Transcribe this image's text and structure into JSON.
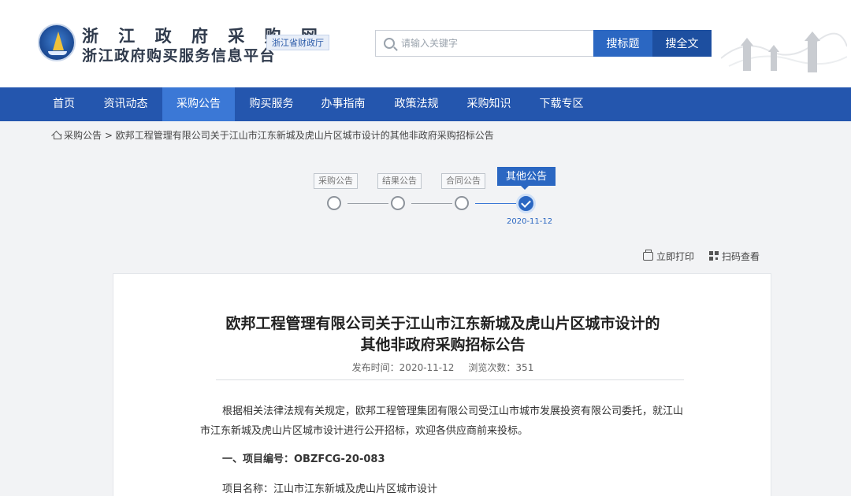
{
  "header": {
    "site_name": "浙 江 政 府 采 购 网",
    "site_subtitle": "浙江政府购买服务信息平台",
    "badge": "浙江省财政厅",
    "search_placeholder": "请输入关键字",
    "search_bid_label": "搜标题",
    "search_all_label": "搜全文"
  },
  "nav": {
    "items": [
      "首页",
      "资讯动态",
      "采购公告",
      "购买服务",
      "办事指南",
      "政策法规",
      "采购知识",
      "下载专区"
    ],
    "active_index": 2
  },
  "breadcrumb": {
    "root": "采购公告",
    "separator": " > ",
    "current": "欧邦工程管理有限公司关于江山市江东新城及虎山片区城市设计的其他非政府采购招标公告"
  },
  "stepper": {
    "steps": [
      "采购公告",
      "结果公告",
      "合同公告",
      "其他公告"
    ],
    "active_step_date": "2020-11-12"
  },
  "tools": {
    "print_label": "立即打印",
    "qr_label": "扫码查看"
  },
  "article": {
    "title_line1": "欧邦工程管理有限公司关于江山市江东新城及虎山片区城市设计的",
    "title_line2": "其他非政府采购招标公告",
    "publish_time": "发布时间：2020-11-12",
    "view_count": "浏览次数：351",
    "paragraph": "根据相关法律法规有关规定，欧邦工程管理集团有限公司受江山市城市发展投资有限公司委托，就江山市江东新城及虎山片区城市设计进行公开招标，欢迎各供应商前来投标。",
    "section1_heading": "一、项目编号：OBZFCG-20-083",
    "project_name": "项目名称：江山市江东新城及虎山片区城市设计"
  },
  "colors": {
    "nav_bg": "#2456ae",
    "nav_active": "#3b78d6",
    "primary_button": "#2b67c2",
    "secondary_button": "#1d4fa0"
  }
}
